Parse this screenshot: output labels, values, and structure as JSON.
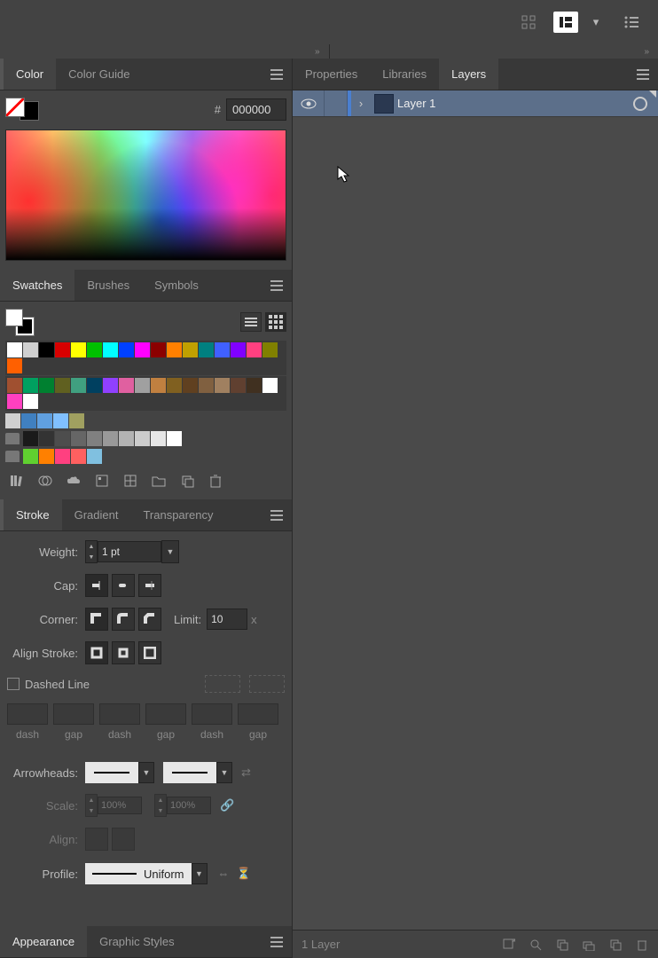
{
  "tabs_left1": {
    "color": "Color",
    "color_guide": "Color Guide"
  },
  "tabs_left2": {
    "swatches": "Swatches",
    "brushes": "Brushes",
    "symbols": "Symbols"
  },
  "tabs_left3": {
    "stroke": "Stroke",
    "gradient": "Gradient",
    "transparency": "Transparency"
  },
  "tabs_left4": {
    "appearance": "Appearance",
    "graphic_styles": "Graphic Styles"
  },
  "tabs_right": {
    "properties": "Properties",
    "libraries": "Libraries",
    "layers": "Layers"
  },
  "color": {
    "hash": "#",
    "hex": "000000"
  },
  "stroke": {
    "weight_label": "Weight:",
    "weight_value": "1 pt",
    "cap_label": "Cap:",
    "corner_label": "Corner:",
    "limit_label": "Limit:",
    "limit_value": "10",
    "limit_suffix": "x",
    "align_label": "Align Stroke:",
    "dashed_label": "Dashed Line",
    "dash_labels": [
      "dash",
      "gap",
      "dash",
      "gap",
      "dash",
      "gap"
    ],
    "arrow_label": "Arrowheads:",
    "scale_label": "Scale:",
    "scale_a": "100%",
    "scale_b": "100%",
    "align2_label": "Align:",
    "profile_label": "Profile:",
    "profile_value": "Uniform"
  },
  "layers": {
    "layer1": "Layer 1",
    "footer_count": "1 Layer"
  },
  "swatch_colors_row1": [
    "#ffffff",
    "#d0d0d0",
    "#000000",
    "#d80000",
    "#ffff00",
    "#00c000",
    "#00ffff",
    "#0040ff",
    "#ff00ff",
    "#8b0000",
    "#ff8000",
    "#c0a000",
    "#008080",
    "#4060ff",
    "#8000ff",
    "#ff4080",
    "#808000",
    "#ff6000"
  ],
  "swatch_colors_row2": [
    "#a05030",
    "#00a060",
    "#008030",
    "#606020",
    "#40a080",
    "#004060",
    "#9040ff",
    "#e060a0",
    "#a0a0a0",
    "#c08040",
    "#806020",
    "#604020",
    "#806040",
    "#a08060",
    "#604030",
    "#403020",
    "#ffffff",
    "#ff40c0",
    "#ffffff"
  ],
  "swatch_colors_row3": [
    "#d0d0d0",
    "#4080c0",
    "#60a0e0",
    "#80c0ff",
    "#a0a060"
  ],
  "gray_row": [
    "#1a1a1a",
    "#333333",
    "#4d4d4d",
    "#666666",
    "#808080",
    "#999999",
    "#b3b3b3",
    "#cccccc",
    "#e6e6e6",
    "#ffffff"
  ],
  "accent_row": [
    "#60d030",
    "#ff8000",
    "#ff4080",
    "#ff6060",
    "#80c0e0"
  ]
}
